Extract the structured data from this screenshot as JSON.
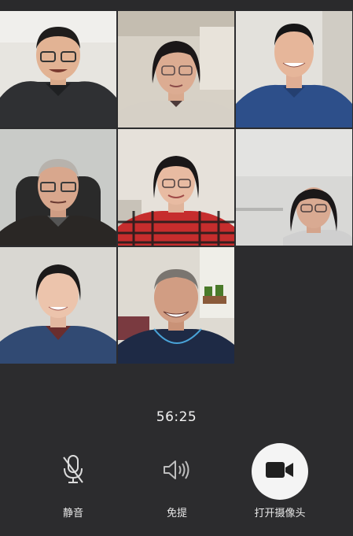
{
  "call": {
    "timer": "56:25"
  },
  "participants": [
    {
      "id": "p1",
      "shirt_color": "#2f3033",
      "bg_color": "#e8e6e2"
    },
    {
      "id": "p2",
      "shirt_color": "#d9d3c9",
      "bg_color": "#d7d1c6"
    },
    {
      "id": "p3",
      "shirt_color": "#2d4f8a",
      "bg_color": "#e5e3df"
    },
    {
      "id": "p4",
      "shirt_color": "#2a2725",
      "bg_color": "#c9cbc8"
    },
    {
      "id": "p5",
      "shirt_color": "#c62d2d",
      "bg_color": "#e7e3dd"
    },
    {
      "id": "p6",
      "shirt_color": "#cfcfcf",
      "bg_color": "#d8d8d6"
    },
    {
      "id": "p7",
      "shirt_color": "#314a73",
      "bg_color": "#d9d7d2"
    },
    {
      "id": "p8",
      "shirt_color": "#1e2a45",
      "bg_color": "#dedad2"
    }
  ],
  "controls": {
    "mute": {
      "label": "静音",
      "icon": "mic-off-icon"
    },
    "speaker": {
      "label": "免提",
      "icon": "speaker-icon"
    },
    "camera": {
      "label": "打开摄像头",
      "icon": "video-camera-icon"
    }
  },
  "colors": {
    "background": "#2c2c2e",
    "text": "#f2f2f2",
    "camera_button": "#f4f4f4"
  }
}
